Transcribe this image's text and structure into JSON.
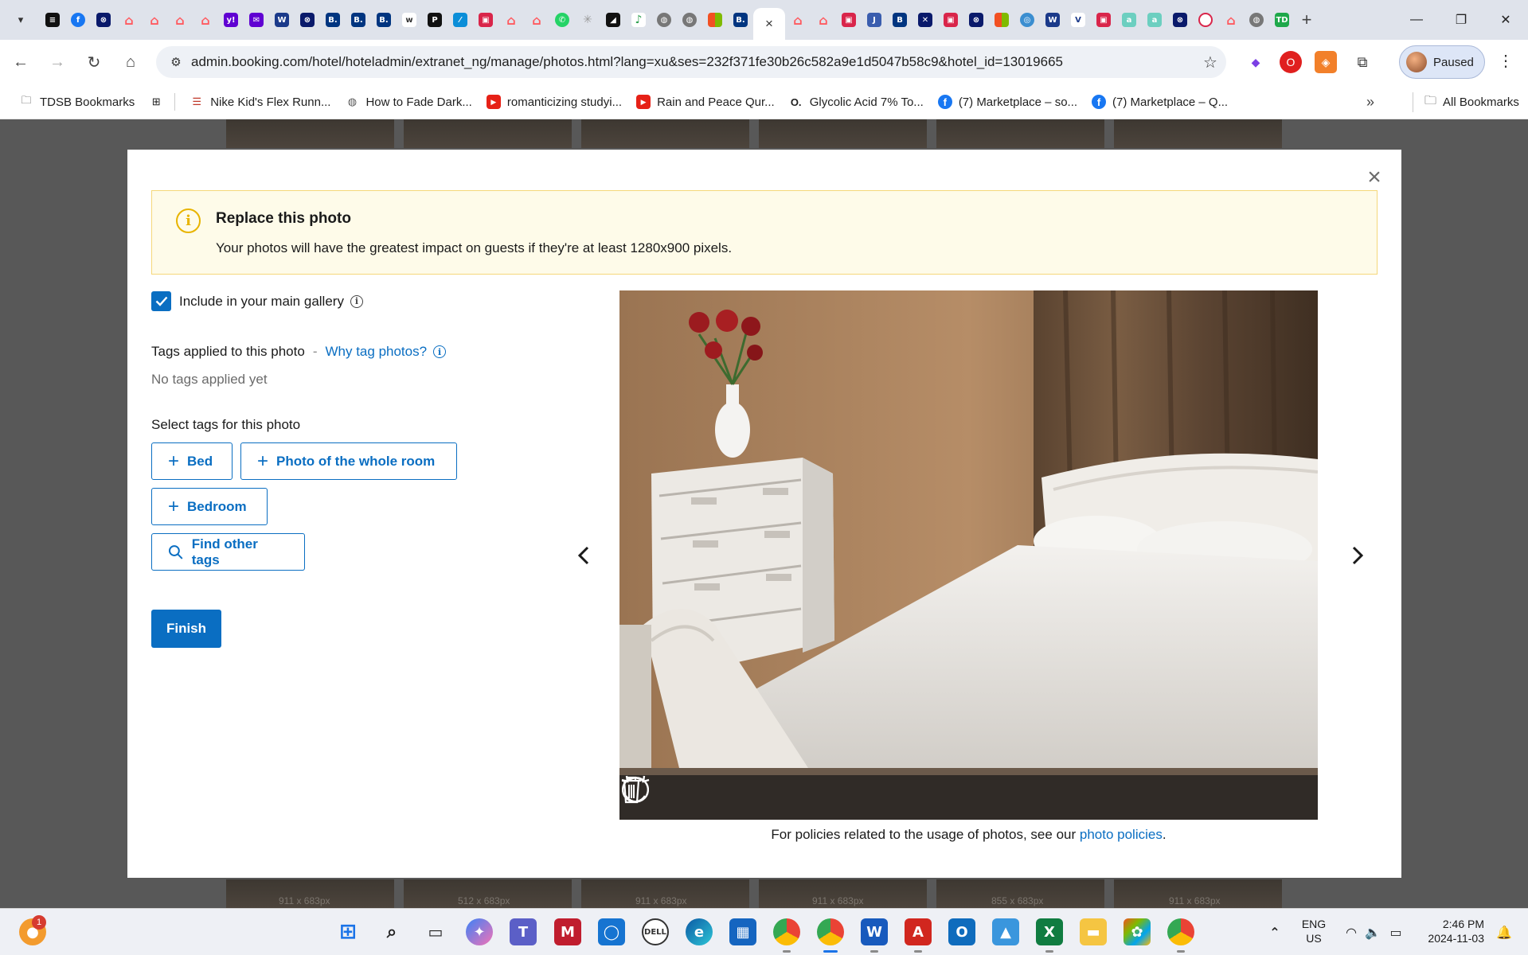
{
  "browser": {
    "tab_list_icon": "chevron-down-icon",
    "active_tab_close": "×",
    "new_tab": "+",
    "window_controls": {
      "minimize": "—",
      "restore": "❐",
      "close": "✕"
    },
    "url": "admin.booking.com/hotel/hoteladmin/extranet_ng/manage/photos.html?lang=xu&ses=232f371fe30b26c582a9e1d5047b58c9&hotel_id=13019665",
    "profile_label": "Paused",
    "bookmarks": [
      {
        "label": "TDSB Bookmarks",
        "icon": "folder-icon"
      },
      {
        "label": "Nike Kid's Flex Runn...",
        "icon": "nike-icon"
      },
      {
        "label": "How to Fade Dark...",
        "icon": "globe-icon"
      },
      {
        "label": "romanticizing studyi...",
        "icon": "youtube-icon"
      },
      {
        "label": "Rain and Peace Qur...",
        "icon": "youtube-icon"
      },
      {
        "label": "Glycolic Acid 7% To...",
        "icon": "ordinary-icon"
      },
      {
        "label": "(7) Marketplace – so...",
        "icon": "facebook-icon"
      },
      {
        "label": "(7) Marketplace – Q...",
        "icon": "facebook-icon"
      }
    ],
    "bookmarks_more": "»",
    "all_bookmarks": "All Bookmarks"
  },
  "modal": {
    "close_symbol": "×",
    "alert": {
      "icon_glyph": "i",
      "title": "Replace this photo",
      "text": "Your photos will have the greatest impact on guests if they're at least 1280x900 pixels."
    },
    "include_gallery": {
      "label": "Include in your main gallery",
      "checked": true
    },
    "tags_applied_label": "Tags applied to this photo",
    "dash": "-",
    "why_tag_link": "Why tag photos?",
    "no_tags": "No tags applied yet",
    "select_tags_label": "Select tags for this photo",
    "tag_buttons": [
      {
        "label": "Bed"
      },
      {
        "label": "Photo of the whole room"
      },
      {
        "label": "Bedroom"
      }
    ],
    "find_tags_button": "Find other tags",
    "finish_button": "Finish",
    "prev_arrow": "‹",
    "next_arrow": "›",
    "policy_text": "For policies related to the usage of photos, see our ",
    "policy_link": "photo policies",
    "policy_end": "."
  },
  "background_thumb_labels": [
    "911 x 683px",
    "512 x 683px",
    "911 x 683px",
    "911 x 683px",
    "855 x 683px",
    "911 x 683px"
  ],
  "taskbar": {
    "notification_count": "1",
    "language": "ENG",
    "region": "US",
    "time": "2:46 PM",
    "date": "2024-11-03"
  },
  "colors": {
    "accent_blue": "#0a6ec2",
    "alert_bg": "#fefbe9",
    "alert_border": "#f5d77a",
    "alert_icon": "#e8b400"
  }
}
